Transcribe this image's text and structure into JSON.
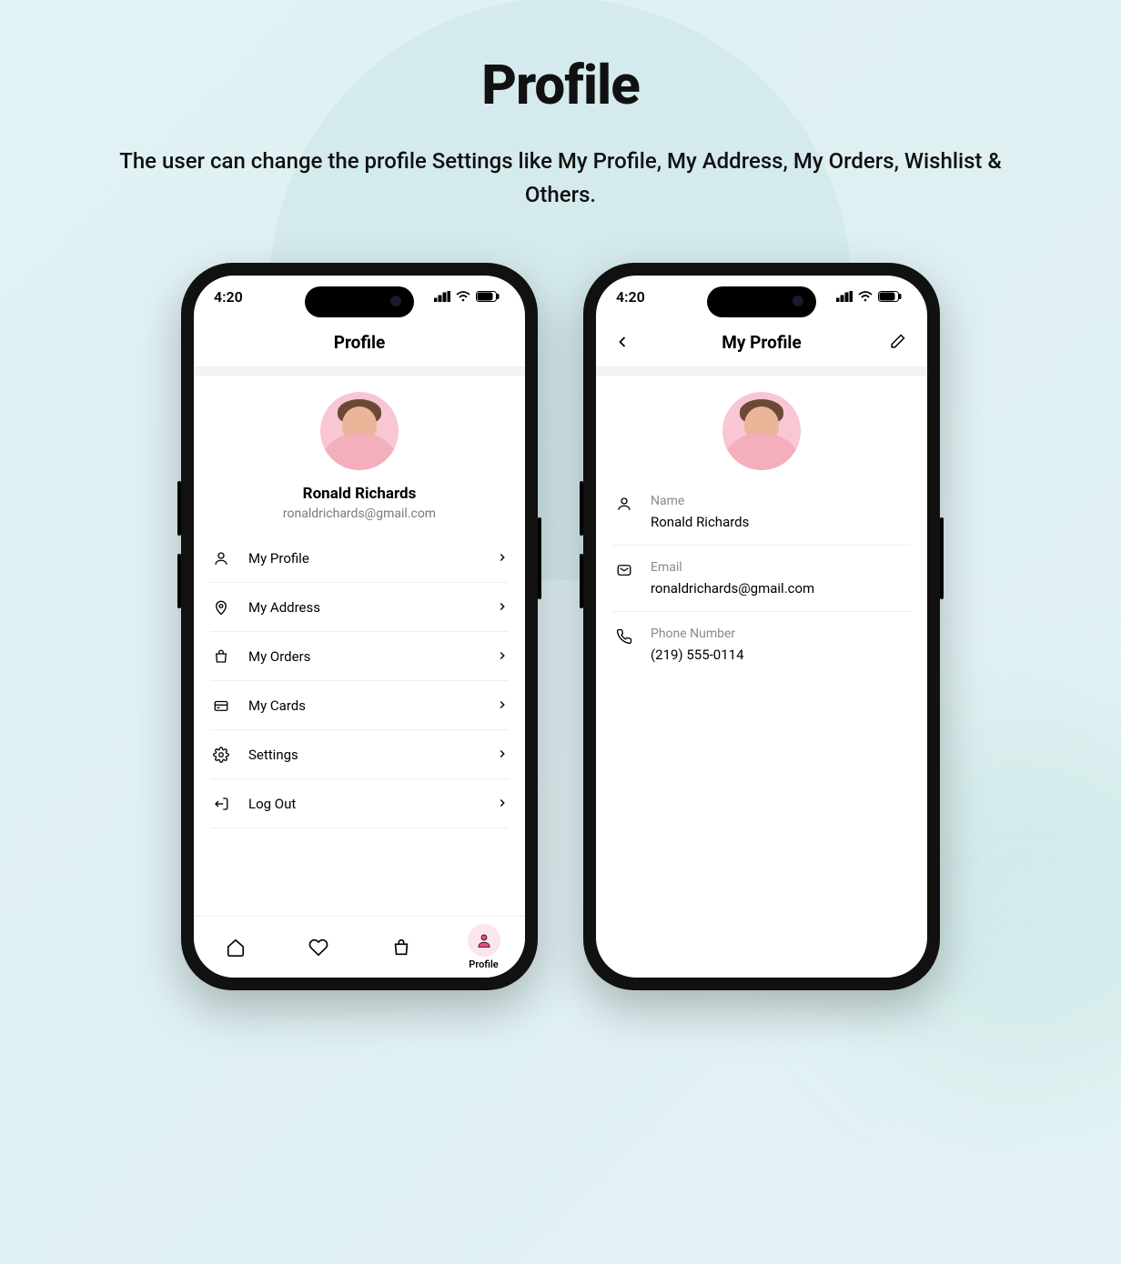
{
  "page": {
    "title": "Profile",
    "subtitle": "The user can change the profile Settings like My Profile, My Address, My Orders, Wishlist & Others."
  },
  "status": {
    "time": "4:20"
  },
  "phone1": {
    "title": "Profile",
    "name": "Ronald Richards",
    "email": "ronaldrichards@gmail.com",
    "menu": {
      "my_profile": "My Profile",
      "my_address": "My Address",
      "my_orders": "My Orders",
      "my_cards": "My Cards",
      "settings": "Settings",
      "log_out": "Log Out"
    },
    "tab_profile_label": "Profile"
  },
  "phone2": {
    "title": "My Profile",
    "fields": {
      "name_label": "Name",
      "name_value": "Ronald Richards",
      "email_label": "Email",
      "email_value": "ronaldrichards@gmail.com",
      "phone_label": "Phone Number",
      "phone_value": "(219) 555-0114"
    }
  }
}
